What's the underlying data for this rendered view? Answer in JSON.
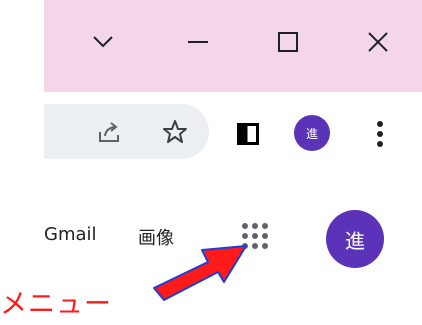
{
  "window_controls": {
    "collapse_icon": "chevron-down-icon",
    "minimize_icon": "minimize-icon",
    "maximize_icon": "maximize-icon",
    "close_icon": "close-icon"
  },
  "toolbar": {
    "share_icon": "share-icon",
    "bookmark_icon": "star-icon",
    "side_panel_icon": "side-panel-icon",
    "profile_avatar_text": "進",
    "menu_icon": "more-vertical-icon"
  },
  "google_header": {
    "gmail_label": "Gmail",
    "images_label": "画像",
    "apps_icon": "apps-grid-icon",
    "account_avatar_text": "進"
  },
  "annotation": {
    "label": "メニュー",
    "color": "#ff1a1a",
    "arrow_icon": "red-arrow-icon"
  },
  "colors": {
    "titlebar_bg": "#f3d6e8",
    "omnibox_bg": "#eceff1",
    "avatar_bg": "#5a33b8"
  }
}
